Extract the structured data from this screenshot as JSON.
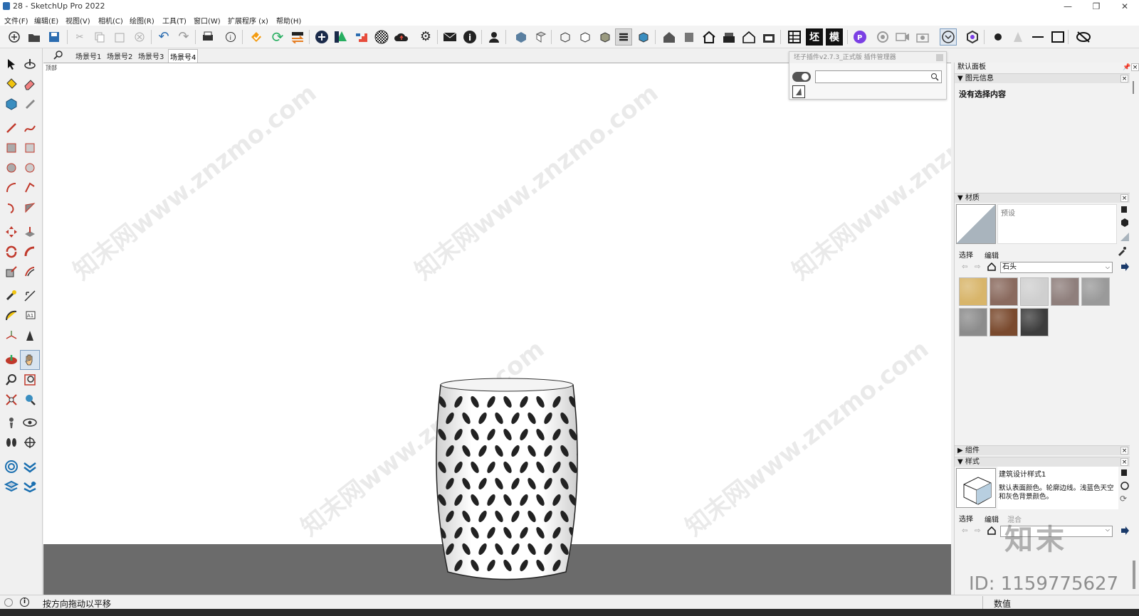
{
  "window": {
    "title": "28 - SketchUp Pro 2022",
    "controls": [
      "—",
      "❐",
      "✕"
    ]
  },
  "menu": [
    "文件(F)",
    "编辑(E)",
    "视图(V)",
    "相机(C)",
    "绘图(R)",
    "工具(T)",
    "窗口(W)",
    "扩展程序 (x)",
    "帮助(H)"
  ],
  "toolbar_text_buttons": [
    "坯",
    "模"
  ],
  "scenes": {
    "search_icon": "magnifier-icon",
    "tabs": [
      "场景号1",
      "场景号2",
      "场景号3",
      "场景号4"
    ],
    "active": "场景号4"
  },
  "viewport": {
    "corner_label": "顶部",
    "watermark": "知末网www.znzmo.com",
    "ground_color": "#6b6b6b",
    "model": "perforated stool"
  },
  "plugin_panel": {
    "title": "坯子插件v2.7.3_正式版 插件管理器",
    "search_placeholder": ""
  },
  "right_panel": {
    "header": "默认面板",
    "entity_info": {
      "title": "图元信息",
      "content": "没有选择内容"
    },
    "materials": {
      "title": "材质",
      "preset_label": "预设",
      "tab_select": "选择",
      "tab_edit": "编辑",
      "library": "石头",
      "swatches": [
        "#d8b56a",
        "#8a6a5e",
        "#cfcfcf",
        "#8f7f7c",
        "#9a9a9a",
        "#8c8c8c",
        "#7a4a2e",
        "#3d3d3d"
      ]
    },
    "components": {
      "title": "组件"
    },
    "styles": {
      "title": "样式",
      "style_name": "建筑设计样式1",
      "style_desc": "默认表面颜色。轮廓边线。浅蓝色天空和灰色背景颜色。",
      "tab_select": "选择",
      "tab_edit": "编辑",
      "tab_mix": "混合"
    }
  },
  "status": {
    "message": "按方向拖动以平移",
    "measure_label": "数值"
  },
  "overlay": {
    "brand": "知末",
    "id_text": "ID: 1159775627"
  },
  "colors": {
    "accent_blue": "#2b6cb0",
    "orange": "#f39c12",
    "green": "#27ae60"
  }
}
